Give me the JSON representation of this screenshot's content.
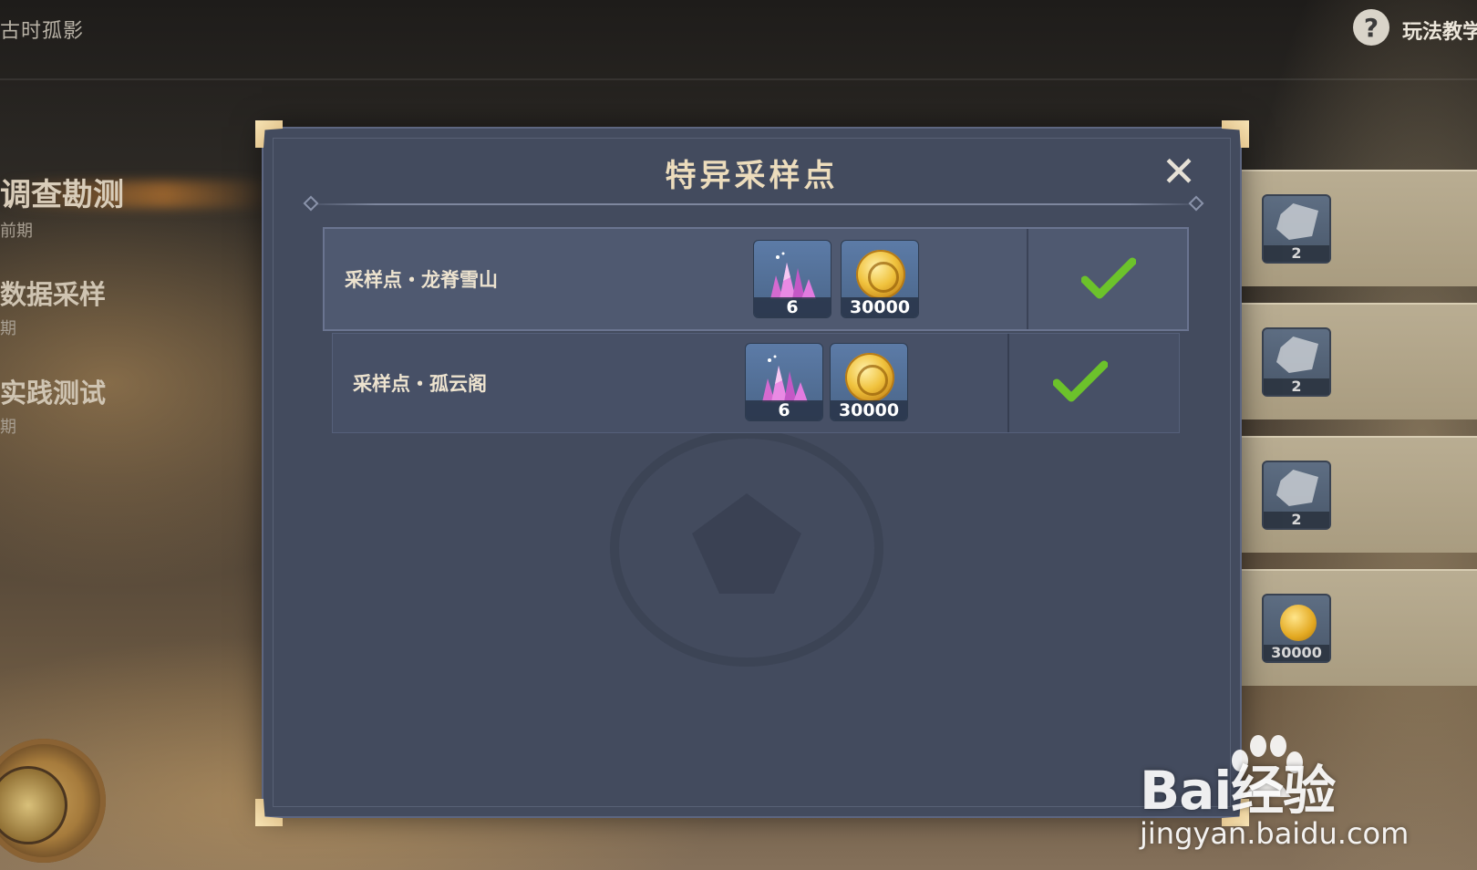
{
  "header": {
    "page_title": "古时孤影",
    "help_label": "玩法教学"
  },
  "left_menu": [
    {
      "label": "调查勘测",
      "sub": "前期"
    },
    {
      "label": "数据采样",
      "sub": "期"
    },
    {
      "label": "实践测试",
      "sub": "期"
    }
  ],
  "right_rewards": [
    {
      "icon": "gear-scroll-icon",
      "count": "2"
    },
    {
      "icon": "gear-scroll-icon",
      "count": "2"
    },
    {
      "icon": "gear-scroll-icon",
      "count": "2"
    },
    {
      "icon": "mora-coin-icon",
      "count": "30000"
    }
  ],
  "modal": {
    "title": "特异采样点",
    "close_icon": "close-icon",
    "rows": [
      {
        "label": "采样点・龙脊雪山",
        "rewards": [
          {
            "icon": "primogem-crystal-icon",
            "count": "6"
          },
          {
            "icon": "mora-coin-icon",
            "count": "30000"
          }
        ],
        "status_icon": "checkmark-icon"
      },
      {
        "label": "采样点・孤云阁",
        "rewards": [
          {
            "icon": "primogem-crystal-icon",
            "count": "6"
          },
          {
            "icon": "mora-coin-icon",
            "count": "30000"
          }
        ],
        "status_icon": "checkmark-icon"
      }
    ]
  },
  "watermark": {
    "brand": "Bai经验",
    "url": "jingyan.baidu.com"
  },
  "colors": {
    "modal_bg": "#434b5e",
    "title_text": "#ecdcbc",
    "check_green": "#6cc22b",
    "corner_gold": "#f0d9a6"
  }
}
